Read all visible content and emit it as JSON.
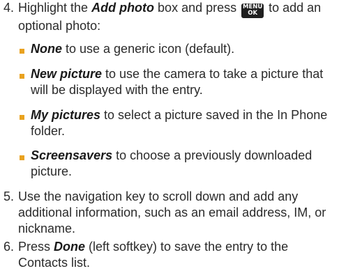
{
  "steps": [
    {
      "number": "4.",
      "text_before": "Highlight the ",
      "em": "Add photo",
      "text_middle": " box and press ",
      "key": {
        "line1": "MENU",
        "line2": "OK"
      },
      "text_after": " to add an optional photo:",
      "bullets": [
        {
          "em": "None",
          "text": " to use a generic icon (default)."
        },
        {
          "em": "New picture",
          "text": " to use the camera to take a picture that will be displayed with the entry."
        },
        {
          "em": "My pictures",
          "text": " to select a picture saved in the In Phone folder."
        },
        {
          "em": "Screensavers",
          "text": " to choose a previously downloaded picture."
        }
      ]
    },
    {
      "number": "5.",
      "text": "Use the navigation key to scroll down and add any additional information, such as an email address, IM, or nickname."
    },
    {
      "number": "6.",
      "text_before": "Press ",
      "em": "Done",
      "text_after": " (left softkey) to save the entry to the Contacts list."
    }
  ],
  "colors": {
    "text": "#2b2b2b",
    "bullet": "#e9a21f",
    "key_background": "#1f1f1f"
  }
}
